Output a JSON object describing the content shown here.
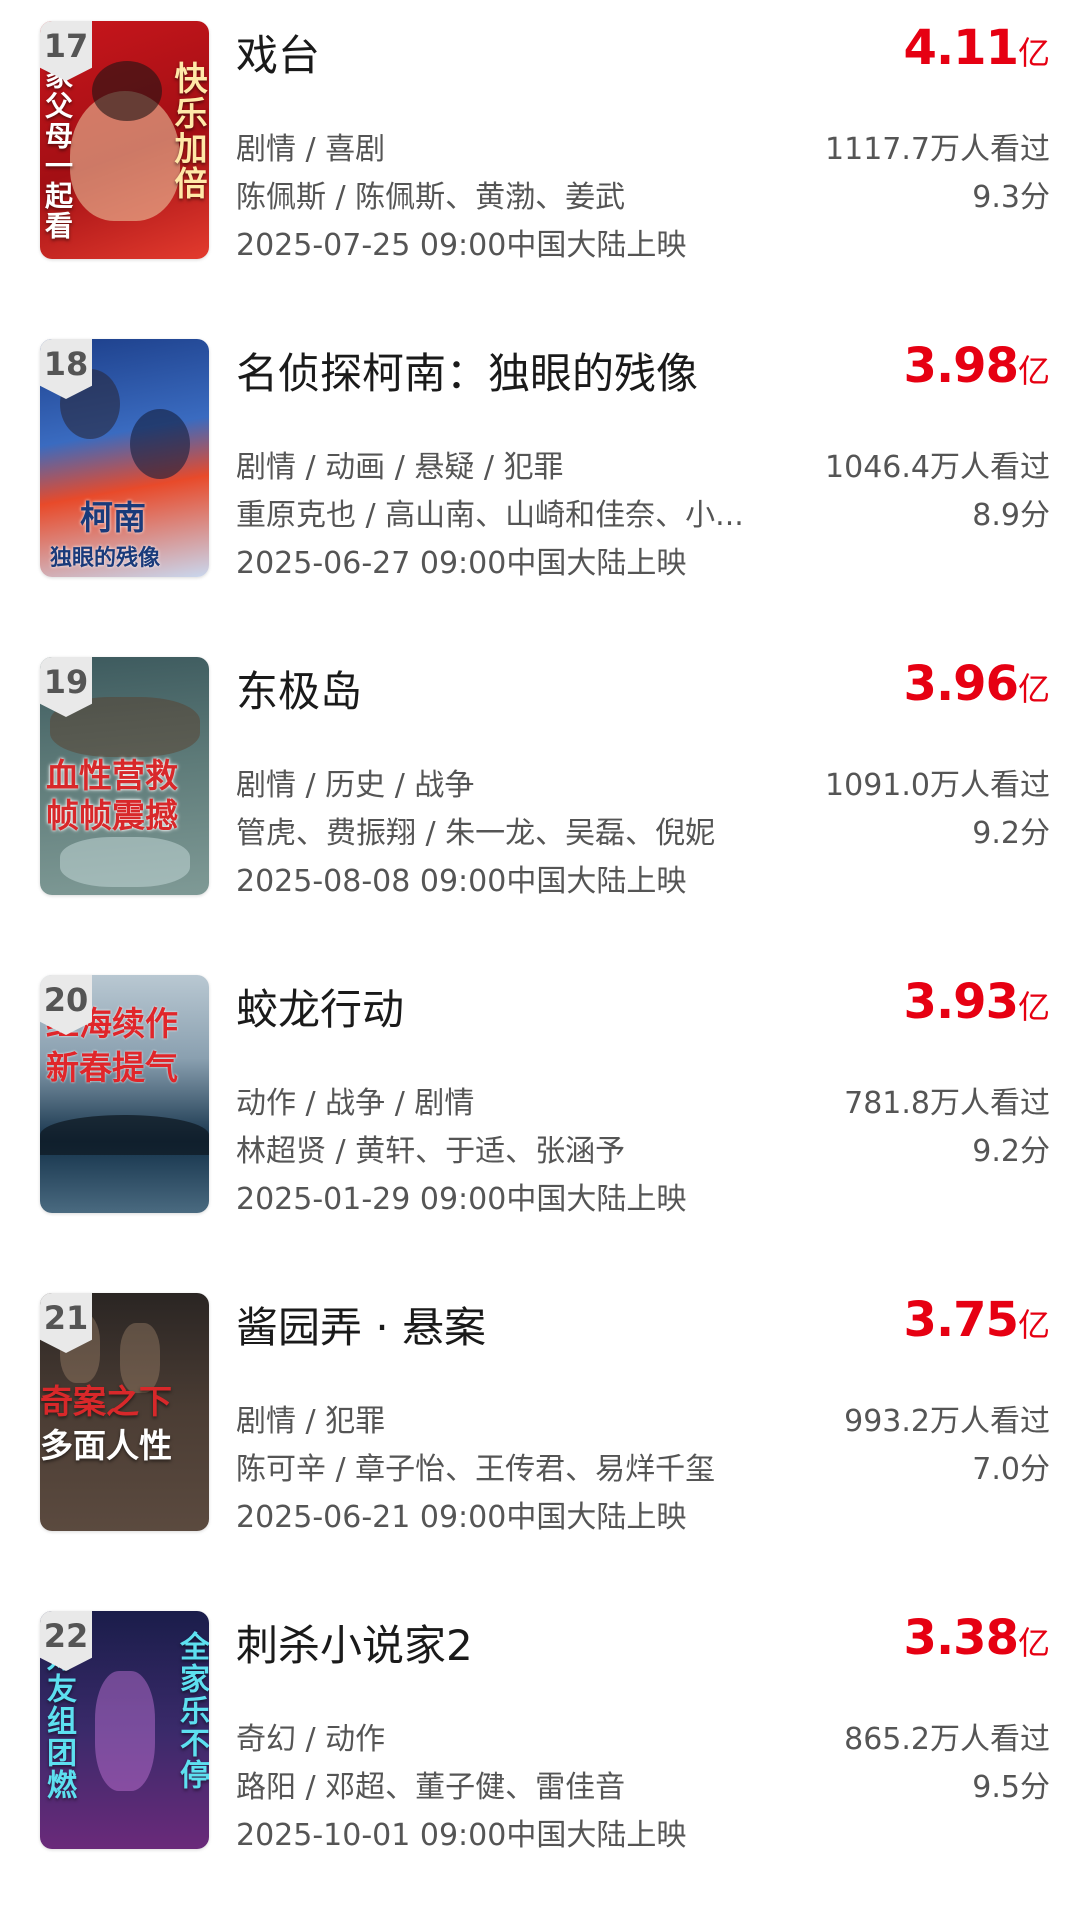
{
  "movies": [
    {
      "rank": "17",
      "title": "戏台",
      "gross_num": "4.11",
      "gross_unit": "亿",
      "genre": "剧情 / 喜剧",
      "crew": "陈佩斯 / 陈佩斯、黄渤、姜武",
      "viewers": "1117.7万人看过",
      "score": "9.3分",
      "release": "2025-07-25 09:00中国大陆上映",
      "poster_text_a": "全家父母一起看",
      "poster_text_b": "快乐加倍",
      "poster_colors": [
        "#c8161c",
        "#e33b2e"
      ]
    },
    {
      "rank": "18",
      "title": "名侦探柯南：独眼的残像",
      "gross_num": "3.98",
      "gross_unit": "亿",
      "genre": "剧情 / 动画 / 悬疑 / 犯罪",
      "crew": "重原克也 / 高山南、山崎和佳奈、小...",
      "viewers": "1046.4万人看过",
      "score": "8.9分",
      "release": "2025-06-27 09:00中国大陆上映",
      "poster_text_a": "柯南",
      "poster_text_b": "独眼的残像",
      "poster_colors": [
        "#1d3f8a",
        "#c9d7ee"
      ]
    },
    {
      "rank": "19",
      "title": "东极岛",
      "gross_num": "3.96",
      "gross_unit": "亿",
      "genre": "剧情 / 历史 / 战争",
      "crew": "管虎、费振翔 / 朱一龙、吴磊、倪妮",
      "viewers": "1091.0万人看过",
      "score": "9.2分",
      "release": "2025-08-08 09:00中国大陆上映",
      "poster_text_a": "血性营救",
      "poster_text_b": "帧帧震撼",
      "poster_colors": [
        "#3d5a5e",
        "#7f9a96"
      ]
    },
    {
      "rank": "20",
      "title": "蛟龙行动",
      "gross_num": "3.93",
      "gross_unit": "亿",
      "genre": "动作 / 战争 / 剧情",
      "crew": "林超贤 / 黄轩、于适、张涵予",
      "viewers": "781.8万人看过",
      "score": "9.2分",
      "release": "2025-01-29 09:00中国大陆上映",
      "poster_text_a": "红海续作",
      "poster_text_b": "新春提气",
      "poster_colors": [
        "#14324a",
        "#4a6a80"
      ]
    },
    {
      "rank": "21",
      "title": "酱园弄 · 悬案",
      "gross_num": "3.75",
      "gross_unit": "亿",
      "genre": "剧情 / 犯罪",
      "crew": "陈可辛 / 章子怡、王传君、易烊千玺",
      "viewers": "993.2万人看过",
      "score": "7.0分",
      "release": "2025-06-21 09:00中国大陆上映",
      "poster_text_a": "奇案之下",
      "poster_text_b": "多面人性",
      "poster_colors": [
        "#2a2523",
        "#5b4a3f"
      ]
    },
    {
      "rank": "22",
      "title": "刺杀小说家2",
      "gross_num": "3.38",
      "gross_unit": "亿",
      "genre": "奇幻 / 动作",
      "crew": "路阳 / 邓超、董子健、雷佳音",
      "viewers": "865.2万人看过",
      "score": "9.5分",
      "release": "2025-10-01 09:00中国大陆上映",
      "poster_text_a": "好友组团燃",
      "poster_text_b": "全家乐不停",
      "poster_colors": [
        "#1a1d4a",
        "#6a2a7a"
      ]
    }
  ]
}
